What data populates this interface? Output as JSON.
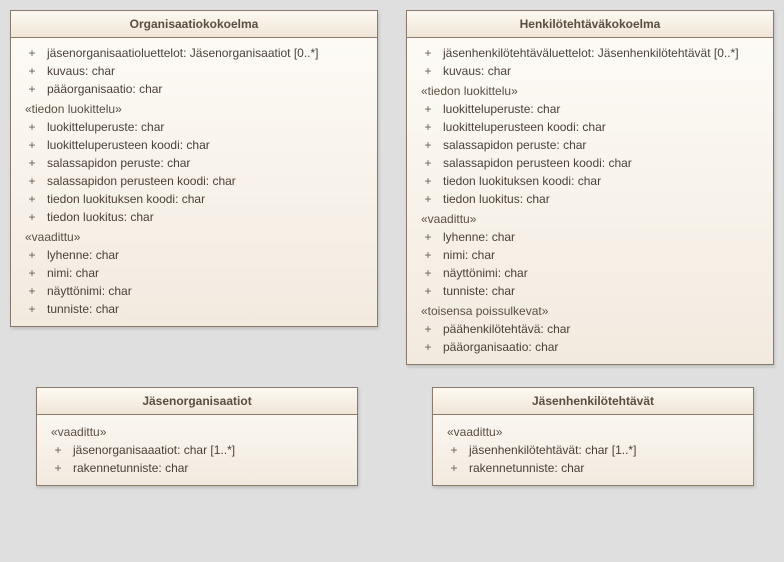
{
  "classes": [
    {
      "id": "organisaatiokokoelma",
      "title": "Organisaatiokokoelma",
      "sections": [
        {
          "stereotype": null,
          "attrs": [
            "jäsenorganisaatioluettelot: Jäsenorganisaatiot [0..*]",
            "kuvaus: char",
            "pääorganisaatio: char"
          ]
        },
        {
          "stereotype": "«tiedon luokittelu»",
          "attrs": [
            "luokitteluperuste: char",
            "luokitteluperusteen koodi: char",
            "salassapidon peruste: char",
            "salassapidon perusteen koodi: char",
            "tiedon luokituksen koodi: char",
            "tiedon luokitus: char"
          ]
        },
        {
          "stereotype": "«vaadittu»",
          "attrs": [
            "lyhenne: char",
            "nimi: char",
            "näyttönimi: char",
            "tunniste: char"
          ]
        }
      ]
    },
    {
      "id": "henkilotehtavakokoelma",
      "title": "Henkilötehtäväkokoelma",
      "sections": [
        {
          "stereotype": null,
          "attrs": [
            "jäsenhenkilötehtäväluettelot: Jäsenhenkilötehtävät [0..*]",
            "kuvaus: char"
          ]
        },
        {
          "stereotype": "«tiedon luokittelu»",
          "attrs": [
            "luokitteluperuste: char",
            "luokitteluperusteen koodi: char",
            "salassapidon peruste: char",
            "salassapidon perusteen koodi: char",
            "tiedon luokituksen koodi: char",
            "tiedon luokitus: char"
          ]
        },
        {
          "stereotype": "«vaadittu»",
          "attrs": [
            "lyhenne: char",
            "nimi: char",
            "näyttönimi: char",
            "tunniste: char"
          ]
        },
        {
          "stereotype": "«toisensa poissulkevat»",
          "attrs": [
            "päähenkilötehtävä: char",
            "pääorganisaatio: char"
          ]
        }
      ]
    },
    {
      "id": "jasenorganisaatiot",
      "title": "Jäsenorganisaatiot",
      "sections": [
        {
          "stereotype": "«vaadittu»",
          "attrs": [
            "jäsenorganisaaatiot: char [1..*]",
            "rakennetunniste: char"
          ]
        }
      ]
    },
    {
      "id": "jasenhenkilotehtavat",
      "title": "Jäsenhenkilötehtävät",
      "sections": [
        {
          "stereotype": "«vaadittu»",
          "attrs": [
            "jäsenhenkilötehtävät: char [1..*]",
            "rakennetunniste: char"
          ]
        }
      ]
    }
  ],
  "vis": "+"
}
